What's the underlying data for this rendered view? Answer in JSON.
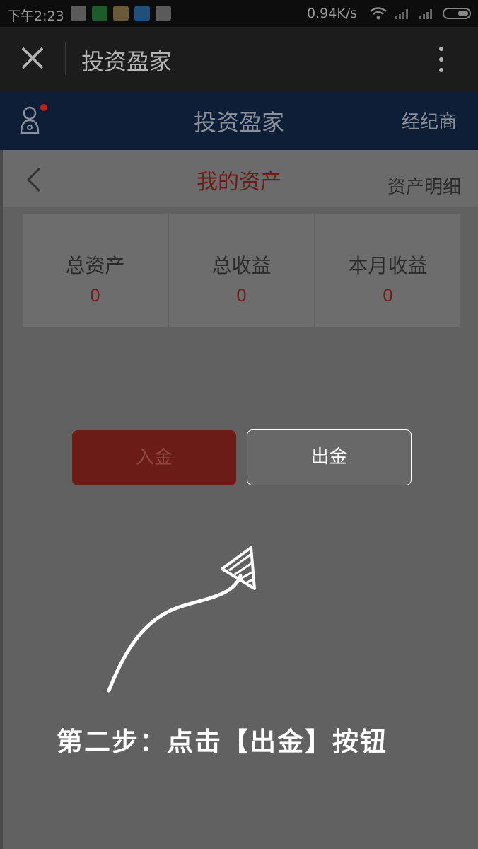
{
  "status_bar": {
    "time": "下午2:23",
    "net_speed": "0.94K/s",
    "app_icons": [
      "play-store-icon",
      "phone-icon",
      "browser-icon",
      "chat-icon",
      "play-store-icon"
    ]
  },
  "title_bar": {
    "title": "投资盈家"
  },
  "app_header": {
    "title": "投资盈家",
    "broker_label": "经纪商"
  },
  "page_nav": {
    "title": "我的资产",
    "detail_label": "资产明细"
  },
  "assets": [
    {
      "label": "总资产",
      "value": "0"
    },
    {
      "label": "总收益",
      "value": "0"
    },
    {
      "label": "本月收益",
      "value": "0"
    }
  ],
  "actions": {
    "deposit_label": "入金",
    "withdraw_label": "出金"
  },
  "guide": {
    "instruction": "第二步：点击【出金】按钮"
  },
  "colors": {
    "title_red": "#6e1c18",
    "deposit_red": "#6b1c16",
    "blue_header": "#0d1e36"
  }
}
